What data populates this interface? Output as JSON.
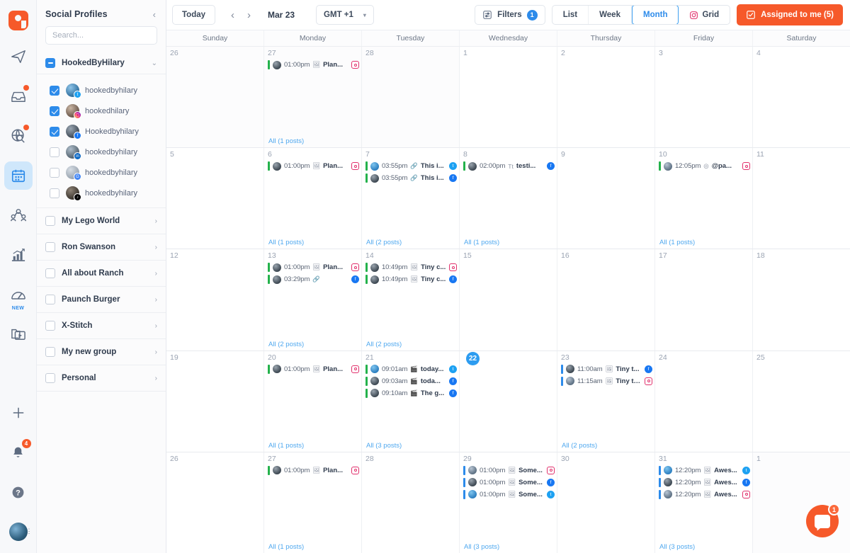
{
  "rail": {
    "logo": "app-logo",
    "items": [
      {
        "name": "publish-icon",
        "icon": "paper-plane",
        "badge": false
      },
      {
        "name": "inbox-icon",
        "icon": "inbox",
        "badge": true
      },
      {
        "name": "monitoring-icon",
        "icon": "globe-search",
        "badge": true
      },
      {
        "name": "calendar-icon",
        "icon": "calendar",
        "badge": false,
        "active": true
      },
      {
        "name": "influencers-icon",
        "icon": "people",
        "badge": false
      },
      {
        "name": "analytics-icon",
        "icon": "bar-chart",
        "badge": false
      },
      {
        "name": "benchmark-icon",
        "icon": "speedometer",
        "badge": false,
        "tag": "NEW"
      },
      {
        "name": "media-library-icon",
        "icon": "media-folder",
        "badge": false
      }
    ],
    "bottom": {
      "add_label": "+",
      "notifications_count": "4",
      "help_label": "?"
    }
  },
  "sidebar": {
    "title": "Social Profiles",
    "collapse_icon": "chevron-left-icon",
    "search": {
      "placeholder": "Search...",
      "value": ""
    },
    "active_group": {
      "label": "HookedByHilary",
      "checkbox_state": "indeterminate",
      "profiles": [
        {
          "name": "hookedbyhilary",
          "network": "twitter",
          "checked": true
        },
        {
          "name": "hookedhilary",
          "network": "instagram",
          "checked": true
        },
        {
          "name": "Hookedbyhilary",
          "network": "facebook",
          "checked": true
        },
        {
          "name": "hookedbyhilary",
          "network": "linkedin",
          "checked": false
        },
        {
          "name": "hookedbyhilary",
          "network": "gmb",
          "checked": false
        },
        {
          "name": "hookedbyhilary",
          "network": "tiktok",
          "checked": false
        }
      ]
    },
    "groups": [
      {
        "label": "My Lego World",
        "checked": false
      },
      {
        "label": "Ron Swanson",
        "checked": false
      },
      {
        "label": "All about Ranch",
        "checked": false
      },
      {
        "label": "Paunch Burger",
        "checked": false
      },
      {
        "label": "X-Stitch",
        "checked": false
      },
      {
        "label": "My new group",
        "checked": false
      },
      {
        "label": "Personal",
        "checked": false
      }
    ]
  },
  "toolbar": {
    "today_label": "Today",
    "prev_label": "‹",
    "next_label": "›",
    "current_date": "Mar 23",
    "timezone": "GMT +1",
    "timezone_caret": "▾",
    "filters_label": "Filters",
    "filters_count": "1",
    "views": [
      {
        "label": "List",
        "active": false,
        "icon": null
      },
      {
        "label": "Week",
        "active": false,
        "icon": null
      },
      {
        "label": "Month",
        "active": true,
        "icon": null
      },
      {
        "label": "Grid",
        "active": false,
        "icon": "instagram-icon"
      }
    ],
    "assigned_label": "Assigned to me (5)",
    "assigned_color": "#f6592a"
  },
  "calendar": {
    "weekdays": [
      "Sunday",
      "Monday",
      "Tuesday",
      "Wednesday",
      "Thursday",
      "Friday",
      "Saturday"
    ],
    "today": 22,
    "all_posts_prefix": "All",
    "weeks": [
      [
        {
          "day": "26",
          "outside": true,
          "posts": [],
          "all": null
        },
        {
          "day": "27",
          "outside": true,
          "posts": [
            {
              "bar": "green",
              "avatar": "dark",
              "time": "01:00pm",
              "type": "image",
              "text": "Plan...",
              "network": "instagram"
            }
          ],
          "all": "All (1 posts)"
        },
        {
          "day": "28",
          "outside": true,
          "posts": [],
          "all": null
        },
        {
          "day": "1",
          "posts": [],
          "all": null
        },
        {
          "day": "2",
          "posts": [],
          "all": null
        },
        {
          "day": "3",
          "posts": [],
          "all": null
        },
        {
          "day": "4",
          "posts": [],
          "all": null
        }
      ],
      [
        {
          "day": "5",
          "posts": [],
          "all": null
        },
        {
          "day": "6",
          "posts": [
            {
              "bar": "green",
              "avatar": "dark",
              "time": "01:00pm",
              "type": "image",
              "text": "Plan...",
              "network": "instagram"
            }
          ],
          "all": "All (1 posts)"
        },
        {
          "day": "7",
          "posts": [
            {
              "bar": "green",
              "avatar": "bluey",
              "time": "03:55pm",
              "type": "link",
              "text": "This i...",
              "network": "twitter"
            },
            {
              "bar": "green",
              "avatar": "dark",
              "time": "03:55pm",
              "type": "link",
              "text": "This i...",
              "network": "facebook"
            }
          ],
          "all": "All (2 posts)"
        },
        {
          "day": "8",
          "posts": [
            {
              "bar": "green",
              "avatar": "dark",
              "time": "02:00pm",
              "type": "text",
              "text": "testi...",
              "network": "facebook"
            }
          ],
          "all": "All (1 posts)"
        },
        {
          "day": "9",
          "posts": [],
          "all": null
        },
        {
          "day": "10",
          "posts": [
            {
              "bar": "green",
              "avatar": "light",
              "time": "12:05pm",
              "type": "story",
              "text": "@pa...",
              "network": "instagram"
            }
          ],
          "all": "All (1 posts)"
        },
        {
          "day": "11",
          "posts": [],
          "all": null
        }
      ],
      [
        {
          "day": "12",
          "posts": [],
          "all": null
        },
        {
          "day": "13",
          "posts": [
            {
              "bar": "green",
              "avatar": "dark",
              "time": "01:00pm",
              "type": "image",
              "text": "Plan...",
              "network": "instagram"
            },
            {
              "bar": "green",
              "avatar": "dark",
              "time": "03:29pm",
              "type": "link",
              "text": "",
              "network": "facebook"
            }
          ],
          "all": "All (2 posts)"
        },
        {
          "day": "14",
          "posts": [
            {
              "bar": "green",
              "avatar": "dark",
              "time": "10:49pm",
              "type": "image",
              "text": "Tiny c...",
              "network": "instagram"
            },
            {
              "bar": "green",
              "avatar": "dark",
              "time": "10:49pm",
              "type": "image",
              "text": "Tiny c...",
              "network": "facebook"
            }
          ],
          "all": "All (2 posts)"
        },
        {
          "day": "15",
          "posts": [],
          "all": null
        },
        {
          "day": "16",
          "posts": [],
          "all": null
        },
        {
          "day": "17",
          "posts": [],
          "all": null
        },
        {
          "day": "18",
          "posts": [],
          "all": null
        }
      ],
      [
        {
          "day": "19",
          "posts": [],
          "all": null
        },
        {
          "day": "20",
          "posts": [
            {
              "bar": "green",
              "avatar": "dark",
              "time": "01:00pm",
              "type": "image",
              "text": "Plan...",
              "network": "instagram"
            }
          ],
          "all": "All (1 posts)"
        },
        {
          "day": "21",
          "posts": [
            {
              "bar": "green",
              "avatar": "bluey",
              "time": "09:01am",
              "type": "video",
              "text": "today...",
              "network": "twitter"
            },
            {
              "bar": "green",
              "avatar": "dark",
              "time": "09:03am",
              "type": "video",
              "text": "toda...",
              "network": "facebook"
            },
            {
              "bar": "green",
              "avatar": "dark",
              "time": "09:10am",
              "type": "video",
              "text": "The g...",
              "network": "facebook"
            }
          ],
          "all": "All (3 posts)"
        },
        {
          "day": "22",
          "today": true,
          "posts": [],
          "all": null
        },
        {
          "day": "23",
          "posts": [
            {
              "bar": "blue",
              "avatar": "dark",
              "time": "11:00am",
              "type": "image",
              "text": "Tiny t...",
              "network": "facebook"
            },
            {
              "bar": "blue",
              "avatar": "light",
              "time": "11:15am",
              "type": "image",
              "text": "Tiny th...",
              "network": "instagram"
            }
          ],
          "all": "All (2 posts)"
        },
        {
          "day": "24",
          "posts": [],
          "all": null
        },
        {
          "day": "25",
          "posts": [],
          "all": null
        }
      ],
      [
        {
          "day": "26",
          "posts": [],
          "all": null
        },
        {
          "day": "27",
          "posts": [
            {
              "bar": "green",
              "avatar": "dark",
              "time": "01:00pm",
              "type": "image",
              "text": "Plan...",
              "network": "instagram"
            }
          ],
          "all": "All (1 posts)"
        },
        {
          "day": "28",
          "posts": [],
          "all": null
        },
        {
          "day": "29",
          "posts": [
            {
              "bar": "blue",
              "avatar": "light",
              "time": "01:00pm",
              "type": "image",
              "text": "Some...",
              "network": "instagram"
            },
            {
              "bar": "blue",
              "avatar": "dark",
              "time": "01:00pm",
              "type": "image",
              "text": "Some...",
              "network": "facebook"
            },
            {
              "bar": "blue",
              "avatar": "bluey",
              "time": "01:00pm",
              "type": "image",
              "text": "Some...",
              "network": "twitter"
            }
          ],
          "all": "All (3 posts)"
        },
        {
          "day": "30",
          "posts": [],
          "all": null
        },
        {
          "day": "31",
          "posts": [
            {
              "bar": "blue",
              "avatar": "bluey",
              "time": "12:20pm",
              "type": "image",
              "text": "Awes...",
              "network": "twitter"
            },
            {
              "bar": "blue",
              "avatar": "dark",
              "time": "12:20pm",
              "type": "image",
              "text": "Awes...",
              "network": "facebook"
            },
            {
              "bar": "blue",
              "avatar": "light",
              "time": "12:20pm",
              "type": "image",
              "text": "Awes...",
              "network": "instagram"
            }
          ],
          "all": "All (3 posts)"
        },
        {
          "day": "1",
          "outside": true,
          "posts": [],
          "all": null
        }
      ]
    ]
  },
  "intercom": {
    "badge": "1",
    "name": "messenger-launcher"
  }
}
